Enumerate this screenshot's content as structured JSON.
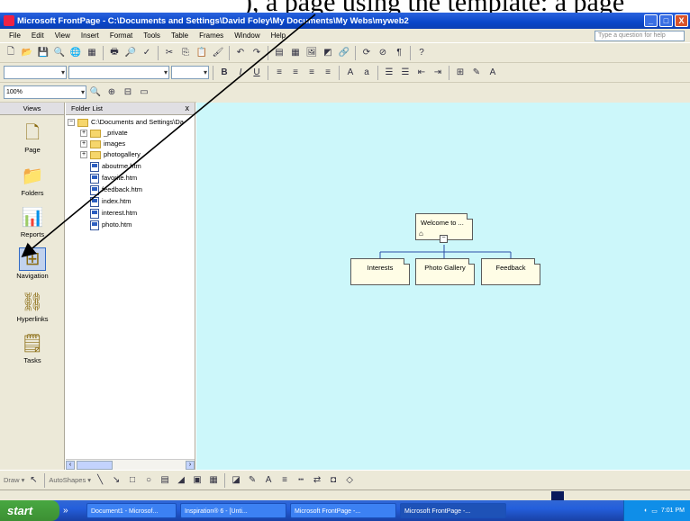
{
  "doc_crop_text": "), a page using the template: a page",
  "window": {
    "title": "Microsoft FrontPage - C:\\Documents and Settings\\David Foley\\My Documents\\My Webs\\myweb2",
    "min": "_",
    "max": "□",
    "close": "X"
  },
  "menu": [
    "File",
    "Edit",
    "View",
    "Insert",
    "Format",
    "Tools",
    "Table",
    "Frames",
    "Window",
    "Help"
  ],
  "ask_placeholder": "Type a question for help",
  "zoom": "100%",
  "views": {
    "header": "Views",
    "items": [
      {
        "label": "Page",
        "icon": "page-view-icon"
      },
      {
        "label": "Folders",
        "icon": "folders-view-icon"
      },
      {
        "label": "Reports",
        "icon": "reports-view-icon"
      },
      {
        "label": "Navigation",
        "icon": "navigation-view-icon"
      },
      {
        "label": "Hyperlinks",
        "icon": "hyperlinks-view-icon"
      },
      {
        "label": "Tasks",
        "icon": "tasks-view-icon"
      }
    ]
  },
  "folder_list": {
    "header": "Folder List",
    "close": "x",
    "root": "C:\\Documents and Settings\\Da",
    "folders": [
      "_private",
      "images",
      "photogallery"
    ],
    "files": [
      "aboutme.htm",
      "favorite.htm",
      "feedback.htm",
      "index.htm",
      "interest.htm",
      "photo.htm"
    ]
  },
  "navigation": {
    "root": "Welcome to ...",
    "children": [
      "Interests",
      "Photo Gallery",
      "Feedback"
    ]
  },
  "drawbar": {
    "draw": "Draw ▾",
    "autoshapes": "AutoShapes ▾"
  },
  "taskbar": {
    "start": "start",
    "tasks": [
      "Document1 - Microsof...",
      "Inspiration® 6 - [Unti...",
      "Microsoft FrontPage -...",
      "Microsoft FrontPage -..."
    ],
    "clock": "7:01 PM"
  },
  "colors": {
    "canvas": "#ccf7fa",
    "titlebar": "#0a47c9",
    "start": "#3c8f33"
  }
}
